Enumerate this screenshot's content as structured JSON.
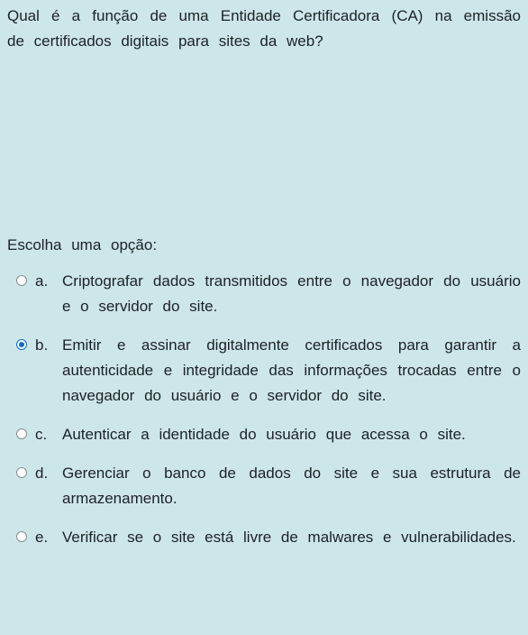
{
  "question": {
    "text": "Qual é a função de uma Entidade Certificadora (CA) na emissão de certificados digitais para sites da web?"
  },
  "prompt": "Escolha uma opção:",
  "options": [
    {
      "letter": "a.",
      "text": "Criptografar dados transmitidos entre o navegador do usuário e o servidor do site.",
      "selected": false
    },
    {
      "letter": "b.",
      "text": "Emitir e assinar digitalmente certificados para garantir a autenticidade e integridade das informações trocadas entre o navegador do usuário e o servidor do site.",
      "selected": true
    },
    {
      "letter": "c.",
      "text": "Autenticar a identidade do usuário que acessa o site.",
      "selected": false
    },
    {
      "letter": "d.",
      "text": "Gerenciar o banco de dados do site e sua estrutura de armazenamento.",
      "selected": false
    },
    {
      "letter": "e.",
      "text": "Verificar se o site está livre de malwares e vulnerabilidades.",
      "selected": false
    }
  ],
  "colors": {
    "background": "#cde6ea",
    "text": "#1d2125",
    "accent": "#0f6cbf"
  }
}
